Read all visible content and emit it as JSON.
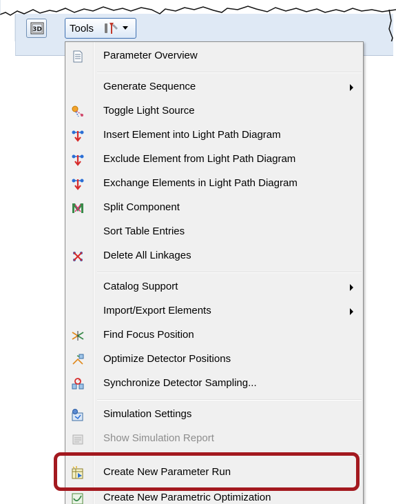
{
  "toolbar": {
    "view3d_label": "3D",
    "tools_label": "Tools"
  },
  "menu": {
    "items": [
      {
        "label": "Parameter Overview",
        "icon": "document-icon"
      },
      {
        "label": "Generate Sequence",
        "submenu": true
      },
      {
        "label": "Toggle Light Source",
        "icon": "light-source-icon"
      },
      {
        "label": "Insert Element into Light Path Diagram",
        "icon": "insert-element-icon"
      },
      {
        "label": "Exclude Element from Light Path Diagram",
        "icon": "exclude-element-icon"
      },
      {
        "label": "Exchange Elements in Light Path Diagram",
        "icon": "exchange-elements-icon"
      },
      {
        "label": "Split Component",
        "icon": "split-component-icon"
      },
      {
        "label": "Sort Table Entries"
      },
      {
        "label": "Delete All Linkages",
        "icon": "delete-linkages-icon"
      },
      {
        "label": "Catalog Support",
        "submenu": true
      },
      {
        "label": "Import/Export Elements",
        "submenu": true
      },
      {
        "label": "Find Focus Position",
        "icon": "find-focus-icon"
      },
      {
        "label": "Optimize Detector Positions",
        "icon": "optimize-detector-icon"
      },
      {
        "label": "Synchronize Detector Sampling...",
        "icon": "synchronize-detector-icon"
      },
      {
        "label": "Simulation Settings",
        "icon": "simulation-settings-icon"
      },
      {
        "label": "Show Simulation Report",
        "icon": "simulation-report-icon",
        "disabled": true
      },
      {
        "label": "Create New Parameter Run",
        "icon": "parameter-run-icon"
      },
      {
        "label": "Create New Parametric Optimization",
        "icon": "parametric-optimization-icon"
      }
    ]
  },
  "colors": {
    "highlight": "#a3191f",
    "toolbar_bg": "#dfe9f5",
    "menu_bg": "#f0f0f0",
    "disabled_text": "#8d8d8d"
  }
}
